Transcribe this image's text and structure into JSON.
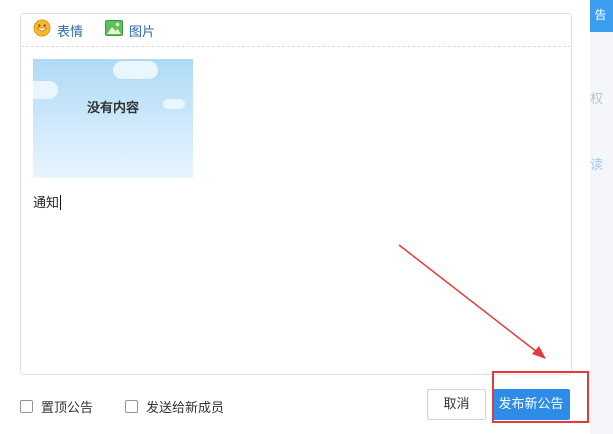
{
  "toolbar": {
    "emoji_label": "表情",
    "image_label": "图片",
    "emoji_icon": "smiley-face-icon",
    "image_icon": "image-icon"
  },
  "editor": {
    "image_placeholder_text": "没有内容",
    "body_text": "通知"
  },
  "options": {
    "pin_label": "置顶公告",
    "send_new_members_label": "发送给新成员"
  },
  "buttons": {
    "cancel_label": "取消",
    "publish_label": "发布新公告"
  },
  "background": {
    "tab_text": "告",
    "faded_1": "权",
    "faded_2": "读"
  },
  "colors": {
    "primary": "#2d8ce8",
    "link": "#2c6aa8",
    "highlight": "#e23b3b"
  }
}
